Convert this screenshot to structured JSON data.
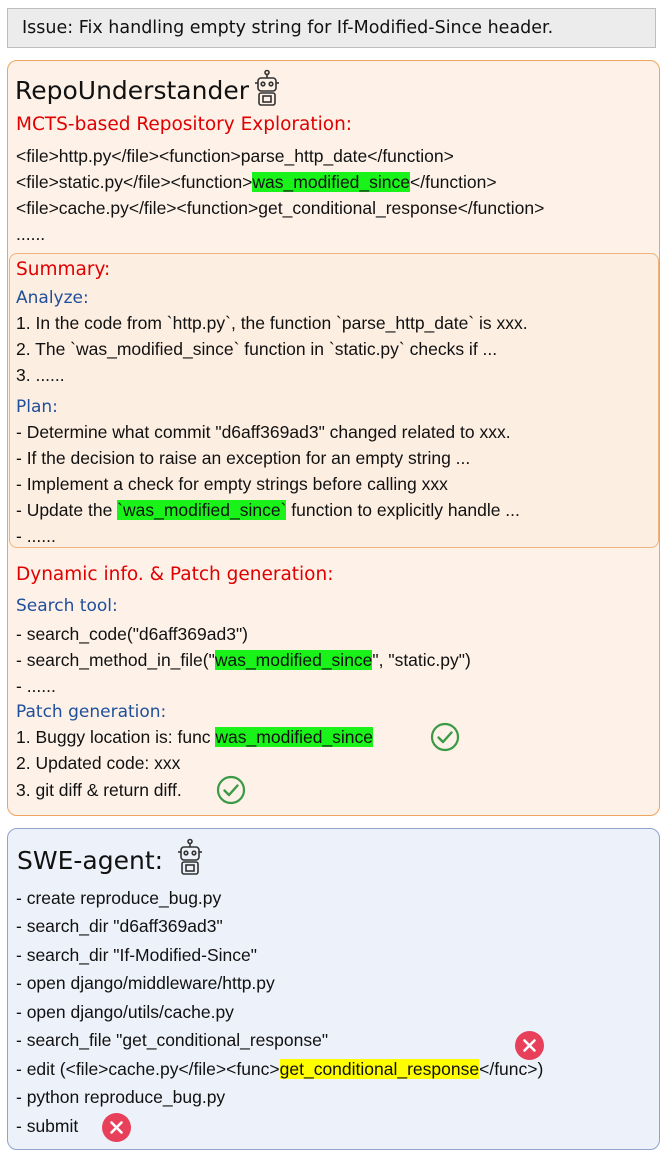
{
  "issue": {
    "text": "Issue: Fix handling empty string for If-Modified-Since header."
  },
  "repo": {
    "title": "RepoUnderstander",
    "mcts": {
      "heading": "MCTS-based Repository Exploration:",
      "lines": [
        {
          "pre": "<file>http.py</file><function>parse_http_date</function>",
          "hl": "",
          "post": ""
        },
        {
          "pre": "<file>static.py</file><function>",
          "hl": "was_modified_since",
          "post": "</function>"
        },
        {
          "pre": "<file>cache.py</file><function>get_conditional_response</function>",
          "hl": "",
          "post": ""
        },
        {
          "pre": "......",
          "hl": "",
          "post": ""
        }
      ]
    },
    "summary": {
      "heading": "Summary:",
      "analyze": {
        "label": "Analyze:",
        "lines": [
          "1. In the code from `http.py`, the function `parse_http_date` is xxx.",
          "2. The `was_modified_since` function in `static.py` checks if ...",
          "3. ......"
        ]
      },
      "plan": {
        "label": "Plan:",
        "lines": [
          {
            "pre": "- Determine what commit \"d6aff369ad3\" changed related to xxx.",
            "hl": "",
            "post": ""
          },
          {
            "pre": "- If the decision to raise an exception for an empty string ...",
            "hl": "",
            "post": ""
          },
          {
            "pre": "- Implement a check for empty strings before calling xxx",
            "hl": "",
            "post": ""
          },
          {
            "pre": "- Update the ",
            "hl": "`was_modified_since`",
            "post": " function to explicitly handle ..."
          },
          {
            "pre": "- ......",
            "hl": "",
            "post": ""
          }
        ]
      }
    },
    "dynamic": {
      "heading": "Dynamic info. & Patch generation:",
      "search": {
        "label": "Search tool:",
        "lines": [
          {
            "pre": "- search_code(\"d6aff369ad3\")",
            "hl": "",
            "post": ""
          },
          {
            "pre": "- search_method_in_file(\"",
            "hl": "was_modified_since",
            "post": "\", \"static.py\")"
          },
          {
            "pre": "- ......",
            "hl": "",
            "post": ""
          }
        ]
      },
      "patch": {
        "label": "Patch generation:",
        "lines": [
          {
            "pre": "1. Buggy location is: func ",
            "hl": "was_modified_since",
            "post": ""
          },
          {
            "pre": "2. Updated code: xxx",
            "hl": "",
            "post": ""
          },
          {
            "pre": "3. git diff & return diff.",
            "hl": "",
            "post": ""
          }
        ]
      }
    }
  },
  "swe": {
    "title": "SWE-agent:",
    "lines": [
      {
        "pre": "- create reproduce_bug.py",
        "hl": "",
        "post": ""
      },
      {
        "pre": "- search_dir \"d6aff369ad3\"",
        "hl": "",
        "post": ""
      },
      {
        "pre": "- search_dir \"If-Modified-Since\"",
        "hl": "",
        "post": ""
      },
      {
        "pre": "- open django/middleware/http.py",
        "hl": "",
        "post": ""
      },
      {
        "pre": "- open django/utils/cache.py",
        "hl": "",
        "post": ""
      },
      {
        "pre": "- search_file \"get_conditional_response\"",
        "hl": "",
        "post": ""
      },
      {
        "pre": "- edit (<file>cache.py</file><func>",
        "hl": "get_conditional_response",
        "post": "</func>)"
      },
      {
        "pre": "- python reproduce_bug.py",
        "hl": "",
        "post": ""
      },
      {
        "pre": "- submit",
        "hl": "",
        "post": ""
      }
    ]
  },
  "icons": {
    "robot": "robot-icon",
    "success": "check-circle-icon",
    "failure": "x-circle-icon",
    "colors": {
      "success": "#3b9a45",
      "failure": "#e8405a",
      "green_highlight": "#19f319",
      "yellow_highlight": "#ffff00"
    }
  }
}
